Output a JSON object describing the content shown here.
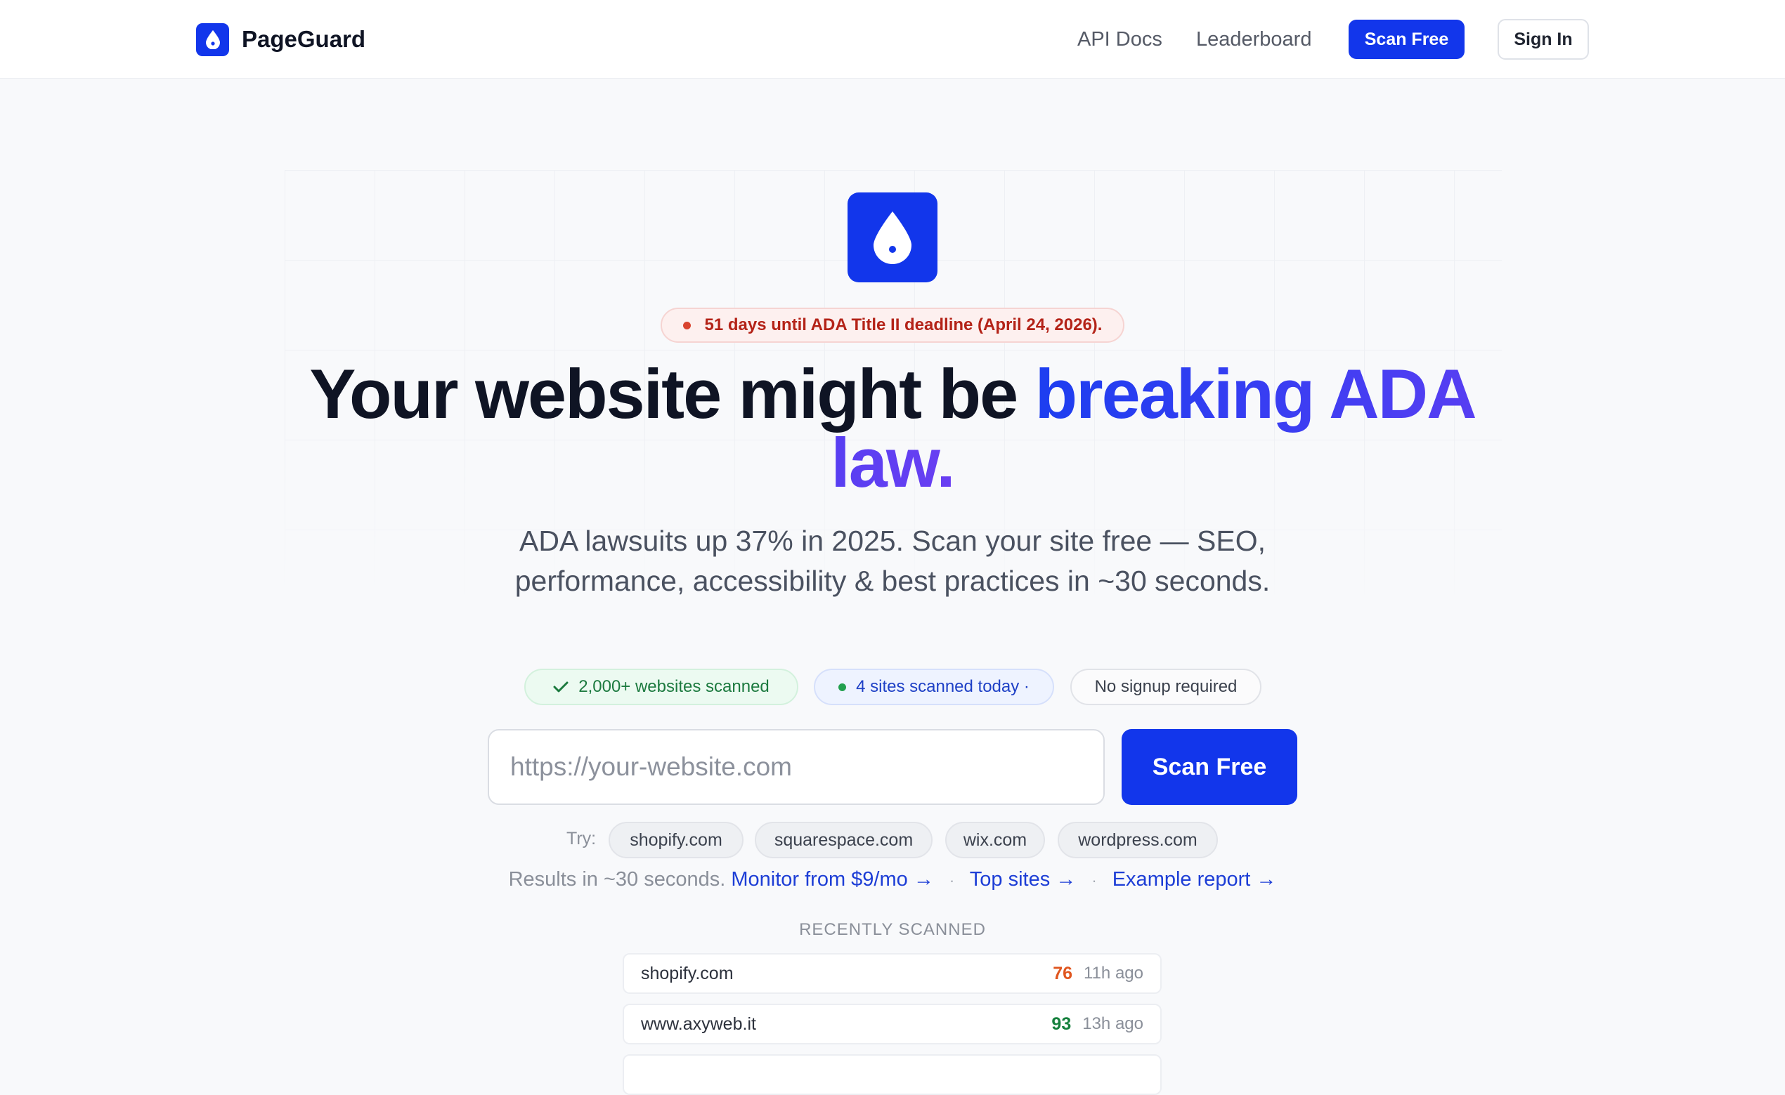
{
  "header": {
    "brand_name": "PageGuard",
    "nav": {
      "api_docs": "API Docs",
      "leaderboard": "Leaderboard",
      "scan_free": "Scan Free",
      "sign_in": "Sign In"
    }
  },
  "hero": {
    "deadline_badge": "51 days until ADA Title II deadline (April 24, 2026).",
    "headline_plain": "Your website might be ",
    "headline_highlight": "breaking ADA law.",
    "subheadline": "ADA lawsuits up 37% in 2025. Scan your site free — SEO, performance, accessibility & best practices in ~30 seconds."
  },
  "stats": {
    "websites_scanned": "2,000+ websites scanned",
    "sites_today": "4 sites scanned today ·",
    "no_signup": "No signup required"
  },
  "scan_form": {
    "placeholder": "https://your-website.com",
    "button_label": "Scan Free",
    "try_label": "Try:",
    "suggestions": [
      "shopify.com",
      "squarespace.com",
      "wix.com",
      "wordpress.com"
    ]
  },
  "info_links": {
    "results_text": "Results in ~30 seconds.",
    "monitor": "Monitor from $9/mo →",
    "top_sites": "Top sites →",
    "example_report": "Example report →",
    "separator": "·"
  },
  "recent": {
    "title": "RECENTLY SCANNED",
    "rows": [
      {
        "domain": "shopify.com",
        "score": "76",
        "time": "11h ago"
      },
      {
        "domain": "www.axyweb.it",
        "score": "93",
        "time": "13h ago"
      }
    ]
  },
  "colors": {
    "brand_blue": "#1236eb",
    "score_orange": "#e0561f",
    "score_green": "#15803d",
    "deadline_red": "#b42318"
  }
}
